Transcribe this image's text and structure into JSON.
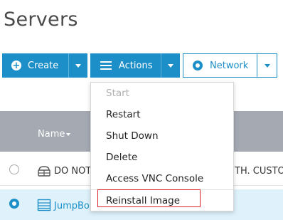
{
  "page": {
    "title": "Servers"
  },
  "toolbar": {
    "create_label": "Create",
    "actions_label": "Actions",
    "network_label": "Network"
  },
  "table": {
    "columns": [
      "Name"
    ],
    "rows": [
      {
        "name": "DO NOT",
        "suffix": "TH. CUSTO.",
        "selected": false
      },
      {
        "name": "JumpBo",
        "selected": true
      }
    ]
  },
  "actions_menu": {
    "items": [
      "Start",
      "Restart",
      "Shut Down",
      "Delete",
      "Access VNC Console",
      "Reinstall Image"
    ],
    "disabled": [
      "Start"
    ],
    "highlighted": "Reinstall Image"
  },
  "colors": {
    "primary": "#1d8fc8",
    "header": "#a4a9b2",
    "selected_row": "#dff2fb",
    "highlight": "#d9242b"
  },
  "icons": [
    "plus-circle-icon",
    "list-icon",
    "network-icon",
    "caret-down-icon",
    "server-icon",
    "image-icon"
  ]
}
